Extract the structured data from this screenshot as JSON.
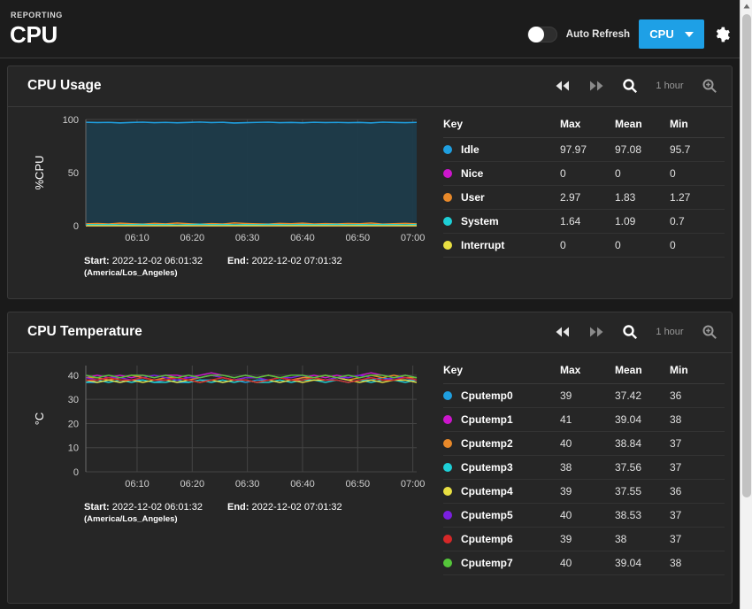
{
  "header": {
    "breadcrumb": "REPORTING",
    "title": "CPU",
    "auto_refresh_label": "Auto Refresh",
    "auto_refresh_state": "off",
    "dropdown_value": "CPU",
    "accent_color": "#1ea0e6",
    "icons": {
      "gear": "gear-icon",
      "caret": "chevron-down-icon"
    }
  },
  "panels": [
    {
      "title": "CPU Usage",
      "toolbar": {
        "rewind": "rewind-icon",
        "forward": "fast-forward-icon",
        "zoom_out": "zoom-out-icon",
        "range": "1 hour",
        "zoom_in": "zoom-in-icon"
      },
      "time": {
        "start_label": "Start:",
        "start_value": "2022-12-02 06:01:32",
        "end_label": "End:",
        "end_value": "2022-12-02 07:01:32",
        "timezone": "(America/Los_Angeles)"
      },
      "legend": {
        "columns": [
          "Key",
          "Max",
          "Mean",
          "Min"
        ],
        "rows": [
          {
            "key": "Idle",
            "color": "#1f9fe0",
            "max": "97.97",
            "mean": "97.08",
            "min": "95.7"
          },
          {
            "key": "Nice",
            "color": "#cc16cc",
            "max": "0",
            "mean": "0",
            "min": "0"
          },
          {
            "key": "User",
            "color": "#e8892a",
            "max": "2.97",
            "mean": "1.83",
            "min": "1.27"
          },
          {
            "key": "System",
            "color": "#1ecfd6",
            "max": "1.64",
            "mean": "1.09",
            "min": "0.7"
          },
          {
            "key": "Interrupt",
            "color": "#e8df42",
            "max": "0",
            "mean": "0",
            "min": "0"
          }
        ]
      }
    },
    {
      "title": "CPU Temperature",
      "toolbar": {
        "rewind": "rewind-icon",
        "forward": "fast-forward-icon",
        "zoom_out": "zoom-out-icon",
        "range": "1 hour",
        "zoom_in": "zoom-in-icon"
      },
      "time": {
        "start_label": "Start:",
        "start_value": "2022-12-02 06:01:32",
        "end_label": "End:",
        "end_value": "2022-12-02 07:01:32",
        "timezone": "(America/Los_Angeles)"
      },
      "legend": {
        "columns": [
          "Key",
          "Max",
          "Mean",
          "Min"
        ],
        "rows": [
          {
            "key": "Cputemp0",
            "color": "#1f9fe0",
            "max": "39",
            "mean": "37.42",
            "min": "36"
          },
          {
            "key": "Cputemp1",
            "color": "#cc16cc",
            "max": "41",
            "mean": "39.04",
            "min": "38"
          },
          {
            "key": "Cputemp2",
            "color": "#e8892a",
            "max": "40",
            "mean": "38.84",
            "min": "37"
          },
          {
            "key": "Cputemp3",
            "color": "#1ecfd6",
            "max": "38",
            "mean": "37.56",
            "min": "37"
          },
          {
            "key": "Cputemp4",
            "color": "#e8df42",
            "max": "39",
            "mean": "37.55",
            "min": "36"
          },
          {
            "key": "Cputemp5",
            "color": "#7a1fe0",
            "max": "40",
            "mean": "38.53",
            "min": "37"
          },
          {
            "key": "Cputemp6",
            "color": "#d62828",
            "max": "39",
            "mean": "38",
            "min": "37"
          },
          {
            "key": "Cputemp7",
            "color": "#55c63a",
            "max": "40",
            "mean": "39.04",
            "min": "38"
          }
        ]
      }
    }
  ],
  "chart_data": [
    {
      "type": "area",
      "title": "CPU Usage",
      "xlabel": "",
      "ylabel": "%CPU",
      "ylim": [
        0,
        100
      ],
      "yticks": [
        0,
        50,
        100
      ],
      "xticks": [
        "06:10",
        "06:20",
        "06:30",
        "06:40",
        "06:50",
        "07:00"
      ],
      "grid": true,
      "legend_position": "right-table",
      "x_start": "2022-12-02 06:01:32",
      "x_end": "2022-12-02 07:01:32",
      "series": [
        {
          "name": "Idle",
          "color": "#1f9fe0",
          "filled": true,
          "values": [
            97.4,
            97.1,
            97.3,
            96.8,
            97.2,
            97.5,
            97.0,
            97.3,
            96.9,
            97.2,
            97.6,
            97.1,
            97.4,
            96.7,
            97.0,
            97.3,
            97.5,
            97.0,
            97.2,
            96.9,
            97.4,
            97.1,
            97.3,
            97.0,
            97.2,
            96.8,
            97.5,
            97.2,
            97.0,
            97.3
          ]
        },
        {
          "name": "Nice",
          "color": "#cc16cc",
          "filled": false,
          "values": [
            0,
            0,
            0,
            0,
            0,
            0,
            0,
            0,
            0,
            0,
            0,
            0,
            0,
            0,
            0,
            0,
            0,
            0,
            0,
            0,
            0,
            0,
            0,
            0,
            0,
            0,
            0,
            0,
            0,
            0
          ]
        },
        {
          "name": "User",
          "color": "#e8892a",
          "filled": false,
          "values": [
            1.8,
            2.1,
            1.7,
            2.4,
            1.9,
            1.6,
            2.2,
            1.8,
            2.5,
            1.9,
            1.5,
            2.0,
            1.7,
            2.6,
            2.1,
            1.8,
            1.6,
            2.2,
            1.9,
            2.4,
            1.7,
            2.0,
            1.8,
            2.1,
            1.9,
            2.5,
            1.6,
            1.9,
            2.2,
            1.8
          ]
        },
        {
          "name": "System",
          "color": "#1ecfd6",
          "filled": false,
          "values": [
            1.1,
            1.0,
            1.2,
            0.9,
            1.1,
            1.3,
            1.0,
            1.2,
            0.8,
            1.1,
            1.4,
            1.0,
            1.2,
            0.9,
            1.1,
            1.0,
            1.3,
            1.1,
            0.9,
            1.2,
            1.0,
            1.1,
            1.3,
            0.9,
            1.1,
            1.0,
            1.2,
            1.1,
            0.9,
            1.2
          ]
        },
        {
          "name": "Interrupt",
          "color": "#e8df42",
          "filled": false,
          "values": [
            0,
            0,
            0,
            0,
            0,
            0,
            0,
            0,
            0,
            0,
            0,
            0,
            0,
            0,
            0,
            0,
            0,
            0,
            0,
            0,
            0,
            0,
            0,
            0,
            0,
            0,
            0,
            0,
            0,
            0
          ]
        }
      ]
    },
    {
      "type": "line",
      "title": "CPU Temperature",
      "xlabel": "",
      "ylabel": "°C",
      "ylim": [
        0,
        44
      ],
      "yticks": [
        0,
        10,
        20,
        30,
        40
      ],
      "xticks": [
        "06:10",
        "06:20",
        "06:30",
        "06:40",
        "06:50",
        "07:00"
      ],
      "grid": true,
      "legend_position": "right-table",
      "x_start": "2022-12-02 06:01:32",
      "x_end": "2022-12-02 07:01:32",
      "series": [
        {
          "name": "Cputemp0",
          "color": "#1f9fe0",
          "values": [
            37,
            37,
            38,
            37,
            38,
            38,
            37,
            38,
            37,
            37,
            38,
            38,
            37,
            38,
            37,
            38,
            38,
            37,
            38,
            38,
            39,
            38,
            38,
            37,
            38,
            38,
            39,
            38,
            38,
            38
          ]
        },
        {
          "name": "Cputemp1",
          "color": "#cc16cc",
          "values": [
            39,
            40,
            39,
            40,
            39,
            40,
            39,
            40,
            40,
            39,
            40,
            41,
            40,
            39,
            40,
            39,
            40,
            39,
            38,
            39,
            40,
            39,
            40,
            39,
            40,
            41,
            40,
            39,
            40,
            39
          ]
        },
        {
          "name": "Cputemp2",
          "color": "#e8892a",
          "values": [
            39,
            39,
            38,
            39,
            40,
            39,
            38,
            39,
            39,
            38,
            39,
            40,
            39,
            38,
            39,
            39,
            40,
            39,
            38,
            39,
            39,
            40,
            39,
            38,
            39,
            40,
            39,
            40,
            39,
            39
          ]
        },
        {
          "name": "Cputemp3",
          "color": "#1ecfd6",
          "values": [
            37,
            38,
            37,
            38,
            37,
            38,
            37,
            37,
            38,
            37,
            38,
            37,
            38,
            37,
            38,
            37,
            37,
            38,
            37,
            38,
            38,
            37,
            38,
            37,
            38,
            37,
            38,
            38,
            37,
            38
          ]
        },
        {
          "name": "Cputemp4",
          "color": "#e8df42",
          "values": [
            38,
            37,
            38,
            37,
            38,
            37,
            38,
            38,
            37,
            38,
            37,
            38,
            37,
            38,
            38,
            37,
            38,
            37,
            38,
            37,
            38,
            38,
            39,
            38,
            37,
            38,
            37,
            38,
            38,
            37
          ]
        },
        {
          "name": "Cputemp5",
          "color": "#7a1fe0",
          "values": [
            39,
            38,
            39,
            39,
            38,
            39,
            40,
            39,
            38,
            39,
            39,
            40,
            39,
            38,
            39,
            39,
            38,
            39,
            39,
            40,
            39,
            38,
            39,
            39,
            40,
            39,
            38,
            39,
            39,
            38
          ]
        },
        {
          "name": "Cputemp6",
          "color": "#d62828",
          "values": [
            38,
            38,
            39,
            38,
            38,
            39,
            38,
            38,
            39,
            38,
            37,
            38,
            39,
            38,
            38,
            37,
            38,
            39,
            38,
            38,
            39,
            38,
            38,
            37,
            38,
            39,
            38,
            38,
            39,
            38
          ]
        },
        {
          "name": "Cputemp7",
          "color": "#55c63a",
          "values": [
            40,
            39,
            40,
            39,
            40,
            40,
            39,
            40,
            39,
            40,
            39,
            40,
            40,
            39,
            40,
            39,
            40,
            39,
            40,
            40,
            39,
            40,
            39,
            40,
            39,
            40,
            40,
            39,
            40,
            39
          ]
        }
      ]
    }
  ],
  "scrollbar": {
    "orientation": "vertical",
    "thumb_icon": "scroll-thumb"
  }
}
